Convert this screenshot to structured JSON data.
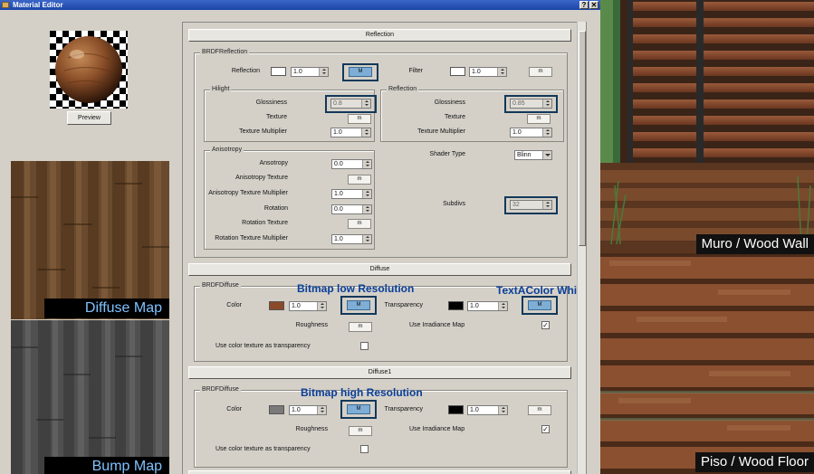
{
  "window": {
    "title": "Material Editor",
    "help_label": "?",
    "close_label": "✕"
  },
  "preview": {
    "button_label": "Preview"
  },
  "left_maps": {
    "diffuse_label": "Diffuse Map",
    "bump_label": "Bump Map"
  },
  "sections": {
    "reflection": "Reflection",
    "diffuse": "Diffuse",
    "diffuse1": "Diffuse1"
  },
  "brdf_reflection": {
    "group_title": "BRDFReflection",
    "reflection_label": "Reflection",
    "reflection_value": "1.0",
    "reflection_map_label": "M",
    "filter_label": "Filter",
    "filter_value": "1.0",
    "filter_map_label": "m",
    "hilight": {
      "group_title": "Hilight",
      "glossiness_label": "Glossiness",
      "glossiness_value": "0.8",
      "texture_label": "Texture",
      "texture_btn": "m",
      "multiplier_label": "Texture Multiplier",
      "multiplier_value": "1.0"
    },
    "reflection_sub": {
      "group_title": "Reflection",
      "glossiness_label": "Glossiness",
      "glossiness_value": "0.85",
      "texture_label": "Texture",
      "texture_btn": "m",
      "multiplier_label": "Texture Multiplier",
      "multiplier_value": "1.0"
    },
    "anisotropy": {
      "group_title": "Anisotropy",
      "anisotropy_label": "Ansotropy",
      "anisotropy_value": "0.0",
      "aniso_texture_label": "Anisotropy Texture",
      "aniso_texture_btn": "m",
      "aniso_mult_label": "Anisotropy Texture Multiplier",
      "aniso_mult_value": "1.0",
      "rotation_label": "Rotation",
      "rotation_value": "0.0",
      "rotation_texture_label": "Rotation Texture",
      "rotation_texture_btn": "m",
      "rotation_mult_label": "Rotation Texture Multiplier",
      "rotation_mult_value": "1.0"
    },
    "shader_type_label": "Shader Type",
    "shader_type_value": "Blinn",
    "subdivs_label": "Subdivs",
    "subdivs_value": "32"
  },
  "brdf_diffuse": {
    "group_title": "BRDFDiffuse",
    "color_label": "Color",
    "color_value": "1.0",
    "color_swatch": "#8a4a2a",
    "color_map_label": "M",
    "transparency_label": "Transparency",
    "transparency_value": "1.0",
    "transparency_swatch": "#000000",
    "transparency_map_label": "M",
    "roughness_label": "Roughness",
    "roughness_btn": "m",
    "irradiance_label": "Use Irradiance Map",
    "irradiance_checked": "✓",
    "color_as_transparency_label": "Use color texture as transparency"
  },
  "brdf_diffuse1": {
    "group_title": "BRDFDiffuse",
    "color_label": "Color",
    "color_value": "1.0",
    "color_swatch": "#7a7a7a",
    "color_map_label": "M",
    "transparency_label": "Transparency",
    "transparency_value": "1.0",
    "transparency_swatch": "#000000",
    "transparency_map_label": "m",
    "roughness_label": "Roughness",
    "roughness_btn": "m",
    "irradiance_label": "Use Irradiance Map",
    "irradiance_checked": "✓",
    "color_as_transparency_label": "Use color texture as transparency"
  },
  "annotations": {
    "bitmap_low": "Bitmap low Resolution",
    "textacolor": "TextAColor White",
    "bitmap_high": "Bitmap high Resolution"
  },
  "photo": {
    "wall_label": "Muro / Wood Wall",
    "floor_label": "Piso / Wood Floor"
  }
}
